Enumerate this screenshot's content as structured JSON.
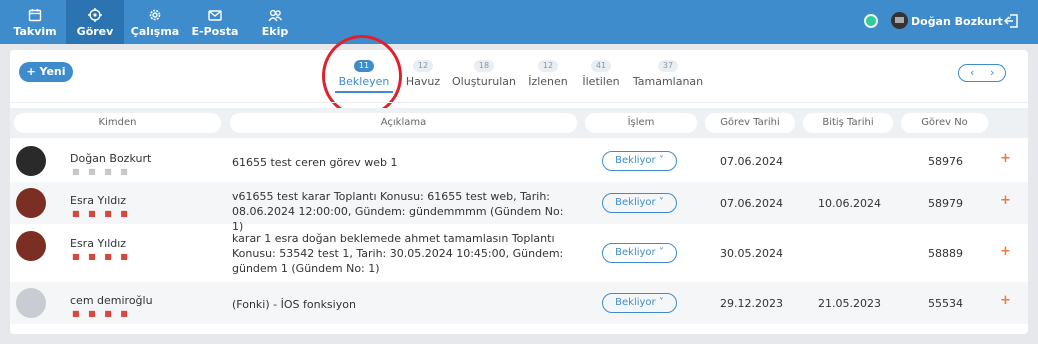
{
  "nav": {
    "items": [
      {
        "label": "Takvim",
        "icon": "calendar-icon"
      },
      {
        "label": "Görev",
        "icon": "target-icon"
      },
      {
        "label": "Çalışma",
        "icon": "gear-icon"
      },
      {
        "label": "E-Posta",
        "icon": "mail-icon"
      },
      {
        "label": "Ekip",
        "icon": "users-icon"
      }
    ],
    "active": "Görev"
  },
  "user": {
    "name": "Doğan Bozkurt",
    "status": "online"
  },
  "toolbar": {
    "new_label": "+ Yeni",
    "prev": "‹",
    "next": "›"
  },
  "tabs": [
    {
      "count": "11",
      "label": "Bekleyen"
    },
    {
      "count": "12",
      "label": "Havuz"
    },
    {
      "count": "18",
      "label": "Oluşturulan"
    },
    {
      "count": "12",
      "label": "İzlenen"
    },
    {
      "count": "41",
      "label": "İletilen"
    },
    {
      "count": "37",
      "label": "Tamamlanan"
    }
  ],
  "columns": [
    "Kimden",
    "Açıklama",
    "İşlem",
    "Görev Tarihi",
    "Bitiş Tarihi",
    "Görev No"
  ],
  "rows": [
    {
      "name": "Doğan Bozkurt",
      "dots": "■ ■ ■ ■",
      "dots_color": "#c8c8c8",
      "description": "61655   test ceren görev web 1",
      "status": "Bekliyor ˅",
      "task_date": "07.06.2024",
      "end_date": "",
      "task_no": "58976",
      "plus": "+"
    },
    {
      "name": "Esra Yıldız",
      "dots": "■ ■ ■ ■",
      "dots_color": "#d9463e",
      "description": "v61655 test karar Toplantı Konusu: 61655 test web, Tarih: 08.06.2024 12:00:00, Gündem: gündemmmm (Gündem No: 1)",
      "status": "Bekliyor ˅",
      "task_date": "07.06.2024",
      "end_date": "10.06.2024",
      "task_no": "58979",
      "plus": "+"
    },
    {
      "name": "Esra Yıldız",
      "dots": "■ ■ ■ ■",
      "dots_color": "#d9463e",
      "description": "karar 1 esra doğan beklemede ahmet tamamlasın Toplantı Konusu: 53542 test 1, Tarih: 30.05.2024 10:45:00, Gündem: gündem 1 (Gündem No: 1)",
      "status": "Bekliyor ˅",
      "task_date": "30.05.2024",
      "end_date": "",
      "task_no": "58889",
      "plus": "+"
    },
    {
      "name": "cem demiroğlu",
      "dots": "■ ■ ■ ■",
      "dots_color": "#d9463e",
      "description": "(Fonki) - İOS fonksiyon",
      "status": "Bekliyor ˅",
      "task_date": "29.12.2023",
      "end_date": "21.05.2023",
      "task_no": "55534",
      "plus": "+"
    }
  ],
  "colors": {
    "primary": "#3e8ccb",
    "nav_active": "#2b74b1",
    "online": "#2ecc9a",
    "accent_plus": "#f0793a",
    "highlight": "#e0202a"
  }
}
